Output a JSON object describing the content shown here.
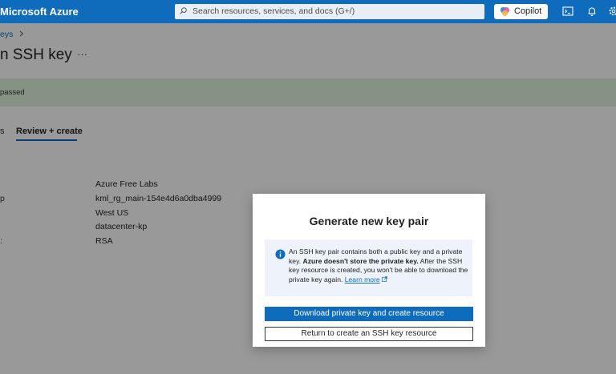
{
  "topbar": {
    "brand": "Microsoft Azure",
    "search_placeholder": "Search resources, services, and docs (G+/)",
    "copilot_label": "Copilot",
    "icons": [
      "cloud-shell-icon",
      "bell-icon",
      "gear-icon"
    ]
  },
  "breadcrumb": "eys",
  "page": {
    "title": "n SSH key",
    "more": "···"
  },
  "banner": {
    "text": "passed",
    "color": "#dff6dd"
  },
  "tabs": {
    "partial": "s",
    "active": "Review + create"
  },
  "summary": {
    "rows": [
      {
        "label": "",
        "value": "Azure Free Labs"
      },
      {
        "label": "p",
        "value": "kml_rg_main-154e4d6a0dba4999"
      },
      {
        "label": "",
        "value": "West US"
      },
      {
        "label": "",
        "value": "datacenter-kp"
      },
      {
        "label": ":",
        "value": "RSA"
      }
    ]
  },
  "dialog": {
    "title": "Generate new key pair",
    "info_pre": "An SSH key pair contains both a public key and a private key. ",
    "info_bold": "Azure doesn't store the private key.",
    "info_post": " After the SSH key resource is created, you won't be able to download the private key again. ",
    "learn_more": "Learn more",
    "primary_button": "Download private key and create resource",
    "secondary_button": "Return to create an SSH key resource"
  },
  "colors": {
    "accent": "#0f6cbd",
    "info_bg": "#eef3fb"
  }
}
